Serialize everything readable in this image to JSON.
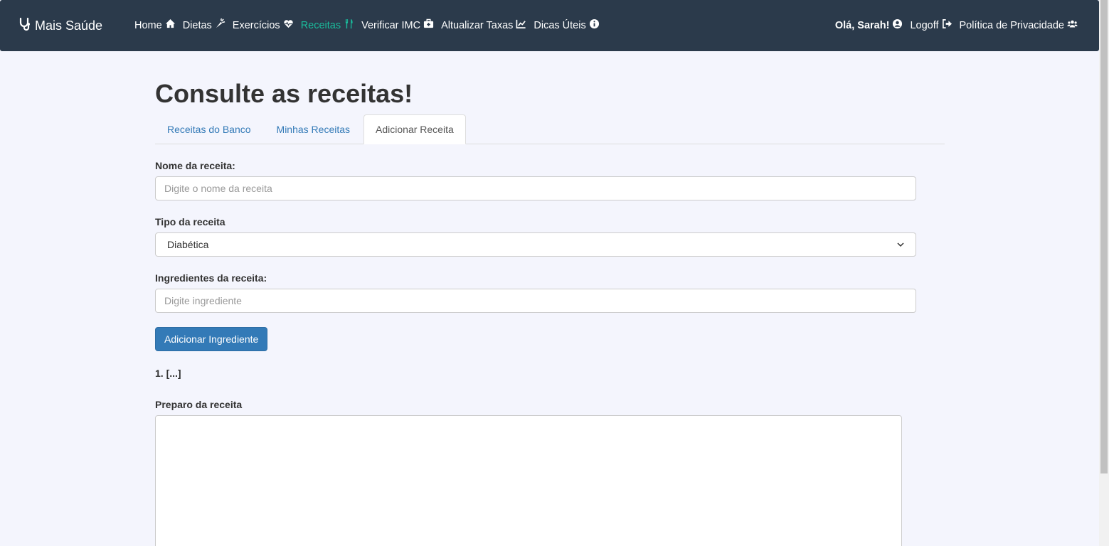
{
  "brand": {
    "name": "Mais Saúde",
    "icon": "stethoscope-icon"
  },
  "nav": {
    "left": [
      {
        "label": "Home",
        "icon": "home-icon",
        "active": false
      },
      {
        "label": "Dietas",
        "icon": "carrot-icon",
        "active": false
      },
      {
        "label": "Exercícios",
        "icon": "heart-pulse-icon",
        "active": false
      },
      {
        "label": "Receitas",
        "icon": "utensils-icon",
        "active": true
      },
      {
        "label": "Verificar IMC",
        "icon": "medical-kit-icon",
        "active": false
      },
      {
        "label": "Altualizar Taxas",
        "icon": "chart-line-icon",
        "active": false
      },
      {
        "label": "Dicas Úteis",
        "icon": "info-circle-icon",
        "active": false
      }
    ],
    "right": [
      {
        "label": "Olá, Sarah!",
        "icon": "user-circle-icon"
      },
      {
        "label": "Logoff",
        "icon": "sign-out-icon"
      },
      {
        "label": "Política de Privacidade",
        "icon": "users-icon"
      }
    ],
    "active_color": "#1abc9c",
    "bg_color": "#2b3a4b"
  },
  "page": {
    "title": "Consulte as receitas!",
    "tabs": [
      {
        "label": "Receitas do Banco",
        "active": false
      },
      {
        "label": "Minhas Receitas",
        "active": false
      },
      {
        "label": "Adicionar Receita",
        "active": true
      }
    ]
  },
  "form": {
    "name_label": "Nome da receita:",
    "name_placeholder": "Digite o nome da receita",
    "type_label": "Tipo da receita",
    "type_value": "Diabética",
    "ingredients_label": "Ingredientes da receita:",
    "ingredient_placeholder": "Digite ingrediente",
    "add_ingredient_button": "Adicionar Ingrediente",
    "ingredient_list": [
      "1. [...]"
    ],
    "prep_label": "Preparo da receita"
  }
}
